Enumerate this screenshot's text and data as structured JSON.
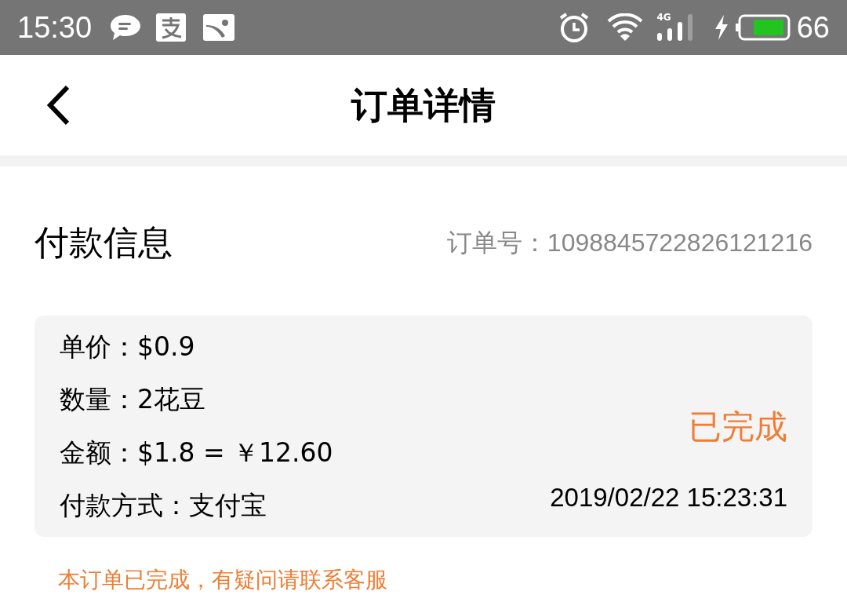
{
  "status_bar": {
    "time": "15:30",
    "network": "4G",
    "battery": "66"
  },
  "header": {
    "title": "订单详情"
  },
  "payment": {
    "title": "付款信息",
    "order_number": "订单号：1098845722826121216",
    "lines": [
      {
        "text": "单价：$0.9"
      },
      {
        "text": "数量：2花豆"
      },
      {
        "text": "金额：$1.8 = ￥12.60"
      },
      {
        "text": "付款方式：支付宝"
      }
    ],
    "status": "已完成",
    "datetime": "2019/02/22 15:23:31"
  },
  "notice": "本订单已完成，有疑问请联系客服"
}
